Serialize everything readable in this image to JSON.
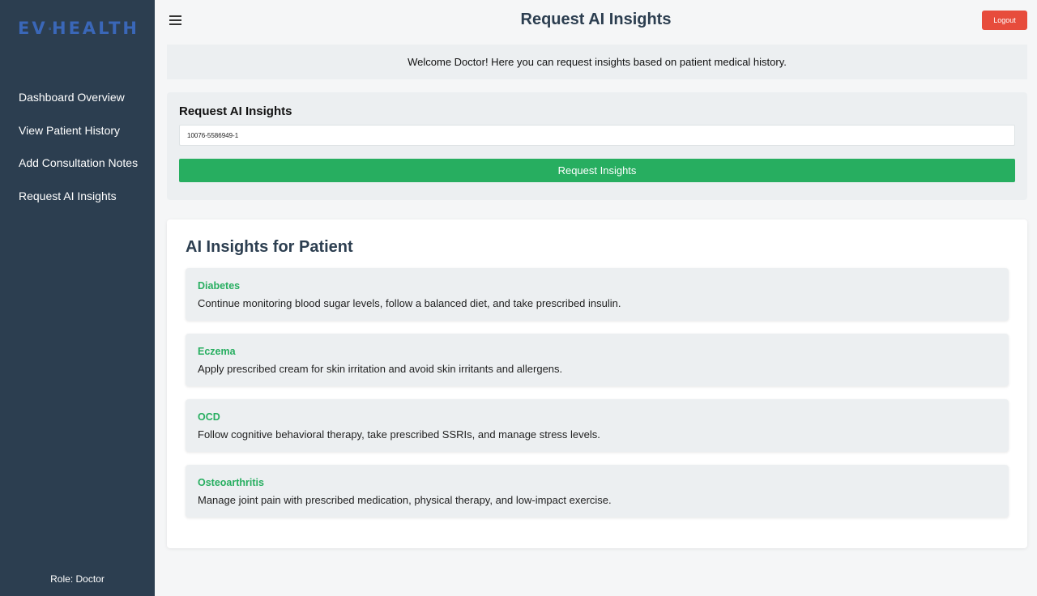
{
  "brand": {
    "name": "EVOHEALTH",
    "left": "EV",
    "right": "HEALTH"
  },
  "sidebar": {
    "items": [
      {
        "label": "Dashboard Overview"
      },
      {
        "label": "View Patient History"
      },
      {
        "label": "Add Consultation Notes"
      },
      {
        "label": "Request AI Insights"
      }
    ],
    "role": "Role: Doctor"
  },
  "header": {
    "title": "Request AI Insights",
    "logout_label": "Logout"
  },
  "welcome": "Welcome Doctor! Here you can request insights based on patient medical history.",
  "request_form": {
    "title": "Request AI Insights",
    "patient_id_value": "10076-5586949-1",
    "button_label": "Request Insights"
  },
  "insights": {
    "title": "AI Insights for Patient",
    "items": [
      {
        "condition": "Diabetes",
        "advice": "Continue monitoring blood sugar levels, follow a balanced diet, and take prescribed insulin."
      },
      {
        "condition": "Eczema",
        "advice": "Apply prescribed cream for skin irritation and avoid skin irritants and allergens."
      },
      {
        "condition": "OCD",
        "advice": "Follow cognitive behavioral therapy, take prescribed SSRIs, and manage stress levels."
      },
      {
        "condition": "Osteoarthritis",
        "advice": "Manage joint pain with prescribed medication, physical therapy, and low-impact exercise."
      }
    ]
  },
  "colors": {
    "sidebar_bg": "#2c3e50",
    "logo": "#3a67b8",
    "accent_green": "#27ae60",
    "logout_red": "#e74c3c"
  }
}
